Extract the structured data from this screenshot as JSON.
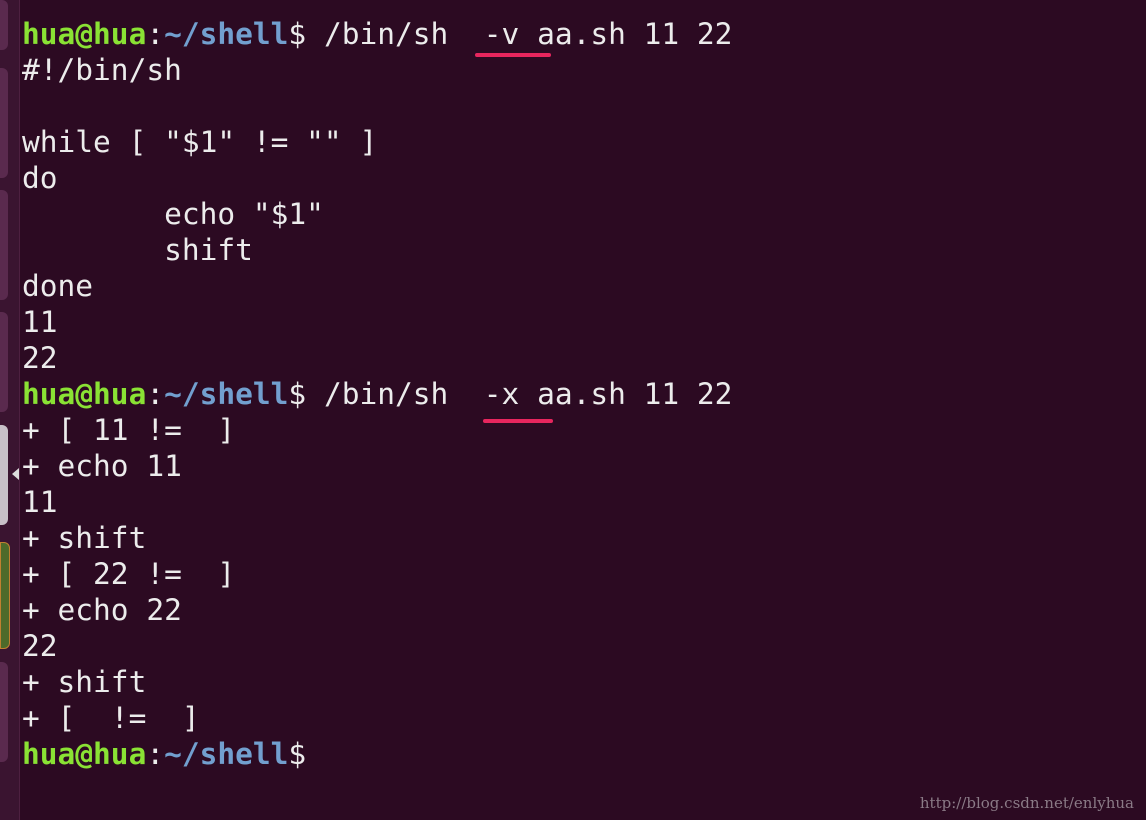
{
  "prompt": {
    "user": "hua@hua",
    "colon": ":",
    "path": "~/shell",
    "symbol": "$"
  },
  "commands": [
    " /bin/sh  -v aa.sh 11 22",
    " /bin/sh  -x aa.sh 11 22",
    ""
  ],
  "output_v": [
    "#!/bin/sh",
    "",
    "while [ \"$1\" != \"\" ]",
    "do",
    "        echo \"$1\"",
    "        shift",
    "done",
    "11",
    "22"
  ],
  "output_x": [
    "+ [ 11 !=  ]",
    "+ echo 11",
    "11",
    "+ shift",
    "+ [ 22 !=  ]",
    "+ echo 22",
    "22",
    "+ shift",
    "+ [  !=  ]"
  ],
  "colors": {
    "background": "#2c0a22",
    "prompt_user": "#8ae234",
    "prompt_path": "#729fcf",
    "annotation_underline": "#e8265e"
  },
  "watermark": "http://blog.csdn.net/enlyhua"
}
